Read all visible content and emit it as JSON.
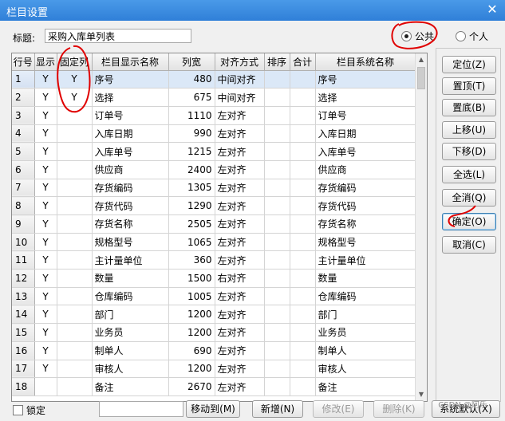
{
  "window": {
    "title": "栏目设置",
    "close_glyph": "✕"
  },
  "form": {
    "title_label": "标题:",
    "title_value": "采购入库单列表"
  },
  "scope": {
    "public_label": "公共",
    "private_label": "个人",
    "selected": "public"
  },
  "grid": {
    "columns": [
      "行号",
      "显示",
      "固定列",
      "栏目显示名称",
      "列宽",
      "对齐方式",
      "排序",
      "合计",
      "栏目系统名称"
    ],
    "rows": [
      [
        "1",
        "Y",
        "Y",
        "序号",
        "480",
        "中间对齐",
        "",
        "",
        "序号"
      ],
      [
        "2",
        "Y",
        "Y",
        "选择",
        "675",
        "中间对齐",
        "",
        "",
        "选择"
      ],
      [
        "3",
        "Y",
        "",
        "订单号",
        "1110",
        "左对齐",
        "",
        "",
        "订单号"
      ],
      [
        "4",
        "Y",
        "",
        "入库日期",
        "990",
        "左对齐",
        "",
        "",
        "入库日期"
      ],
      [
        "5",
        "Y",
        "",
        "入库单号",
        "1215",
        "左对齐",
        "",
        "",
        "入库单号"
      ],
      [
        "6",
        "Y",
        "",
        "供应商",
        "2400",
        "左对齐",
        "",
        "",
        "供应商"
      ],
      [
        "7",
        "Y",
        "",
        "存货编码",
        "1305",
        "左对齐",
        "",
        "",
        "存货编码"
      ],
      [
        "8",
        "Y",
        "",
        "存货代码",
        "1290",
        "左对齐",
        "",
        "",
        "存货代码"
      ],
      [
        "9",
        "Y",
        "",
        "存货名称",
        "2505",
        "左对齐",
        "",
        "",
        "存货名称"
      ],
      [
        "10",
        "Y",
        "",
        "规格型号",
        "1065",
        "左对齐",
        "",
        "",
        "规格型号"
      ],
      [
        "11",
        "Y",
        "",
        "主计量单位",
        "360",
        "左对齐",
        "",
        "",
        "主计量单位"
      ],
      [
        "12",
        "Y",
        "",
        "数量",
        "1500",
        "右对齐",
        "",
        "",
        "数量"
      ],
      [
        "13",
        "Y",
        "",
        "仓库编码",
        "1005",
        "左对齐",
        "",
        "",
        "仓库编码"
      ],
      [
        "14",
        "Y",
        "",
        "部门",
        "1200",
        "左对齐",
        "",
        "",
        "部门"
      ],
      [
        "15",
        "Y",
        "",
        "业务员",
        "1200",
        "左对齐",
        "",
        "",
        "业务员"
      ],
      [
        "16",
        "Y",
        "",
        "制单人",
        "690",
        "左对齐",
        "",
        "",
        "制单人"
      ],
      [
        "17",
        "Y",
        "",
        "审核人",
        "1200",
        "左对齐",
        "",
        "",
        "审核人"
      ],
      [
        "18",
        "",
        "",
        "备注",
        "2670",
        "左对齐",
        "",
        "",
        "备注"
      ]
    ],
    "selected_row_index": 0
  },
  "side_buttons": [
    "定位(Z)",
    "置顶(T)",
    "置底(B)",
    "上移(U)",
    "下移(D)",
    "全选(L)",
    "全消(Q)",
    "确定(O)",
    "取消(C)"
  ],
  "bottom": {
    "lock_label": "锁定",
    "move_to_label": "移动到(M)",
    "add_label": "新增(N)",
    "edit_label": "修改(E)",
    "delete_label": "删除(K)",
    "default_label": "系统默认(X)"
  },
  "watermark": "CSDN @阿乐",
  "colors": {
    "titlebar": "#2f7fd8",
    "annotation": "#e00000",
    "selection": "#dbe8f7"
  }
}
